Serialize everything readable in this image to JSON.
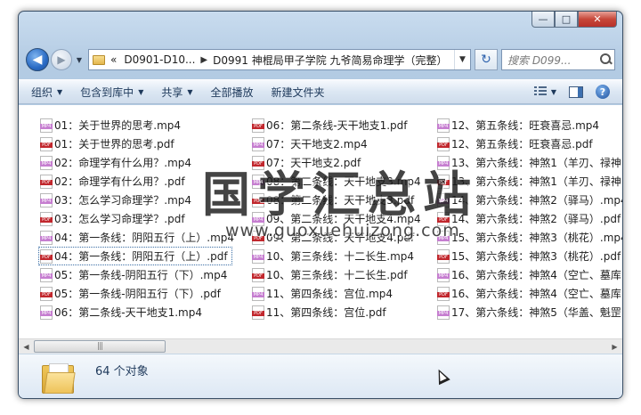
{
  "window": {
    "caption": {
      "minimize": "—",
      "maximize": "□",
      "close": "✕"
    }
  },
  "nav": {
    "back_icon": "arrow-left-icon",
    "address": {
      "prefix": "«",
      "crumb1": "D0901-D10...",
      "crumb2": "D0991 神棍局甲子学院 九爷简易命理学（完整）"
    },
    "search_placeholder": "搜索 D099..."
  },
  "toolbar": {
    "organize": "组织",
    "include_in_library": "包含到库中",
    "share": "共享",
    "play_all": "全部播放",
    "new_folder": "新建文件夹"
  },
  "files": {
    "col1": [
      {
        "name": "01：关于世界的思考.mp4",
        "type": "mp4"
      },
      {
        "name": "01：关于世界的思考.pdf",
        "type": "pdf"
      },
      {
        "name": "02：命理学有什么用？.mp4",
        "type": "mp4"
      },
      {
        "name": "02：命理学有什么用？.pdf",
        "type": "pdf"
      },
      {
        "name": "03：怎么学习命理学？.mp4",
        "type": "mp4"
      },
      {
        "name": "03：怎么学习命理学？.pdf",
        "type": "pdf"
      },
      {
        "name": "04：第一条线：阴阳五行（上）.mp4",
        "type": "mp4"
      },
      {
        "name": "04：第一条线：阴阳五行（上）.pdf",
        "type": "pdf",
        "selected": true
      },
      {
        "name": "05：第一条线-阴阳五行（下）.mp4",
        "type": "mp4"
      },
      {
        "name": "05：第一条线-阴阳五行（下）.pdf",
        "type": "pdf"
      },
      {
        "name": "06：第二条线-天干地支1.mp4",
        "type": "mp4"
      }
    ],
    "col2": [
      {
        "name": "06：第二条线-天干地支1.pdf",
        "type": "pdf"
      },
      {
        "name": "07：天干地支2.mp4",
        "type": "mp4"
      },
      {
        "name": "07：天干地支2.pdf",
        "type": "pdf"
      },
      {
        "name": "08：第二条线：天干地支3.mp4",
        "type": "mp4"
      },
      {
        "name": "08：第二条线：天干地支3.pdf",
        "type": "pdf"
      },
      {
        "name": "09、第二条线：天干地支4.mp4",
        "type": "mp4"
      },
      {
        "name": "09、第二条线：天干地支4.pdf",
        "type": "pdf"
      },
      {
        "name": "10、第三条线：十二长生.mp4",
        "type": "mp4"
      },
      {
        "name": "10、第三条线：十二长生.pdf",
        "type": "pdf"
      },
      {
        "name": "11、第四条线：宫位.mp4",
        "type": "mp4"
      },
      {
        "name": "11、第四条线：宫位.pdf",
        "type": "pdf"
      }
    ],
    "col3": [
      {
        "name": "12、第五条线：旺衰喜忌.mp4",
        "type": "mp4"
      },
      {
        "name": "12、第五条线：旺衰喜忌.pdf",
        "type": "pdf"
      },
      {
        "name": "13、第六条线：神煞1（羊刃、禄神",
        "type": "mp4"
      },
      {
        "name": "13、第六条线：神煞1（羊刃、禄神",
        "type": "pdf"
      },
      {
        "name": "14、第六条线：神煞2（驿马）.mp4",
        "type": "mp4"
      },
      {
        "name": "14、第六条线：神煞2（驿马）.pdf",
        "type": "pdf"
      },
      {
        "name": "15、第六条线：神煞3（桃花）.mp4",
        "type": "mp4"
      },
      {
        "name": "15、第六条线：神煞3（桃花）.pdf",
        "type": "pdf"
      },
      {
        "name": "16、第六条线：神煞4（空亡、墓库",
        "type": "mp4"
      },
      {
        "name": "16、第六条线：神煞4（空亡、墓库",
        "type": "pdf"
      },
      {
        "name": "17、第六条线：神煞5（华盖、魁罡",
        "type": "mp4"
      }
    ]
  },
  "watermark": {
    "big": "国学汇总站",
    "small": "www.guoxuehuizong.com"
  },
  "scrollbar": {
    "left": "◀",
    "right": "▶",
    "grip": "|||"
  },
  "details": {
    "count": "64 个对象"
  }
}
